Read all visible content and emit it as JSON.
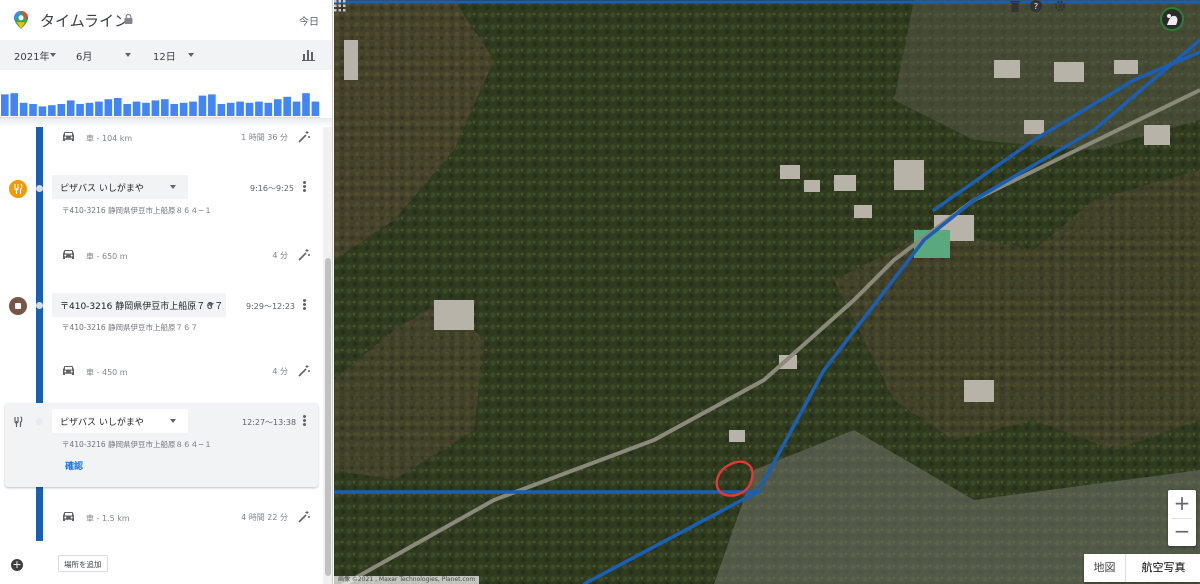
{
  "app": {
    "title": "タイムライン",
    "today_link": "今日"
  },
  "date": {
    "year": "2021年",
    "month": "6月",
    "day": "12日"
  },
  "histogram": {
    "color": "#4285f4",
    "values": [
      0.9,
      0.95,
      0.55,
      0.5,
      0.4,
      0.45,
      0.5,
      0.65,
      0.5,
      0.55,
      0.6,
      0.7,
      0.75,
      0.5,
      0.6,
      0.55,
      0.65,
      0.7,
      0.5,
      0.55,
      0.6,
      0.85,
      0.9,
      0.5,
      0.55,
      0.6,
      0.55,
      0.6,
      0.55,
      0.7,
      0.8,
      0.6,
      0.95,
      0.6
    ]
  },
  "timeline": {
    "track_color": "#1a5fb4",
    "segments": [
      {
        "mode": "車",
        "distance": "104 km",
        "duration": "1 時間 36 分"
      },
      {
        "mode": "車",
        "distance": "650 m",
        "duration": "4 分"
      },
      {
        "mode": "車",
        "distance": "450 m",
        "duration": "4 分"
      },
      {
        "mode": "車",
        "distance": "1.5 km",
        "duration": "4 時間 22 分"
      }
    ],
    "places": [
      {
        "icon": "restaurant-icon",
        "icon_color": "#f29900",
        "name": "ピザバス いしがまや",
        "time": "9:16〜9:25",
        "address": "〒410-3216 静岡県伊豆市上船原８６４−１"
      },
      {
        "icon": "stop-icon",
        "icon_color": "#795548",
        "name": "〒410-3216 静岡県伊豆市上船原７６７",
        "time": "9:29〜12:23",
        "address": "〒410-3216 静岡県伊豆市上船原７６７"
      },
      {
        "icon": "restaurant-icon",
        "icon_color": "#ffffff",
        "name": "ピザバス いしがまや",
        "time": "12:27〜13:38",
        "address": "〒410-3216 静岡県伊豆市上船原８６４−１",
        "confirm": "確認"
      }
    ],
    "add_place": "場所を追加"
  },
  "map": {
    "route_color": "#1a5fb4",
    "marker_color": "#e53935",
    "zoom_in": "+",
    "zoom_out": "−",
    "type_map": "地図",
    "type_satellite": "航空写真",
    "attribution": "画像 ©2021 , Maxar Technologies, Planet.com"
  }
}
